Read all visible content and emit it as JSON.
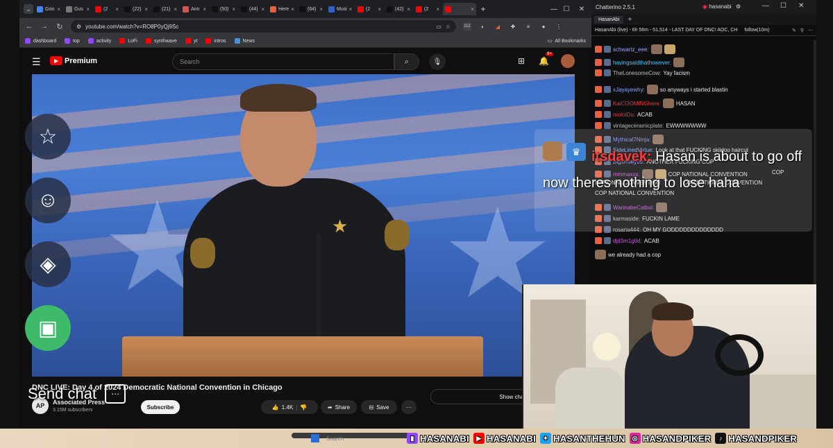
{
  "browser": {
    "tabs": [
      {
        "label": "Goo",
        "color": "#4285f4"
      },
      {
        "label": "Gus",
        "color": "#777777"
      },
      {
        "label": "(2",
        "color": "#ff0000"
      },
      {
        "label": "(22)",
        "color": "#111111"
      },
      {
        "label": "(21)",
        "color": "#111111"
      },
      {
        "label": "Ann",
        "color": "#d9534f"
      },
      {
        "label": "(50)",
        "color": "#111111"
      },
      {
        "label": "(44)",
        "color": "#111111"
      },
      {
        "label": "Here",
        "color": "#e8603c"
      },
      {
        "label": "(64)",
        "color": "#111111"
      },
      {
        "label": "Musi",
        "color": "#2f5fd0"
      },
      {
        "label": "(2",
        "color": "#ff0000"
      },
      {
        "label": "(42)",
        "color": "#111111"
      },
      {
        "label": "(2",
        "color": "#ff0000"
      },
      {
        "label": "",
        "color": "#ff0000",
        "active": true
      }
    ],
    "url": "youtube.com/watch?v=RO8P0yQj9Sc",
    "bookmarks": [
      {
        "label": "dashboard",
        "color": "#9146ff"
      },
      {
        "label": "top",
        "color": "#9146ff"
      },
      {
        "label": "activity",
        "color": "#9146ff"
      },
      {
        "label": "LoFi",
        "color": "#ff0000"
      },
      {
        "label": "synthwave",
        "color": "#ff0000"
      },
      {
        "label": "yt",
        "color": "#ff0000"
      },
      {
        "label": "intros",
        "color": "#ff0000"
      },
      {
        "label": "News",
        "color": "#4a90d9"
      }
    ],
    "all_bookmarks": "All Bookmarks",
    "extension_badge": "112"
  },
  "youtube": {
    "logo": "Premium",
    "search_placeholder": "Search",
    "notification_count": "9+",
    "video_title": "DNC LIVE: Day 4 of 2024 Democratic National Convention in Chicago",
    "channel_initials": "AP",
    "channel_name": "Associated Press",
    "subscribers": "3.15M subscribers",
    "subscribe_label": "Subscribe",
    "like_count": "1.4K",
    "share_label": "Share",
    "save_label": "Save",
    "more_label": "···",
    "show_chat": "Show chat"
  },
  "chatterino": {
    "app_title": "Chatterino 2.5.1",
    "account": "hasanabi",
    "tab": "HasanAbi",
    "channel_header": "HasanAbi (live) - 6h 56m - 51,514 - LAST DAY OF DNC! AOC, CH",
    "follow_status": "follow(10m)",
    "messages": [
      {
        "user": "schwartz_eee:",
        "color": "#9ea7ff",
        "text": "",
        "emotes": 2
      },
      {
        "user": "havingsaidthathowever:",
        "color": "#4fc3f7",
        "text": "",
        "emotes": 1
      },
      {
        "user": "TheLonesomeCow:",
        "color": "#bdbdbd",
        "text": "Yay facism",
        "emotes": 0
      },
      {
        "user": "xJayayewhy:",
        "color": "#7ea8ff",
        "text": "so anyways i started blastin",
        "emotes": 1
      },
      {
        "user": "KaiCOOMINGhere:",
        "color": "#e23b3b",
        "text": "HASAN",
        "emotes": 1
      },
      {
        "user": "molotDu:",
        "color": "#e23b3b",
        "text": "ACAB",
        "emotes": 0
      },
      {
        "user": "vintageceramicplate:",
        "color": "#bdbdbd",
        "text": "EWWWWWWW",
        "emotes": 0
      },
      {
        "user": "Mythical7Ninja:",
        "color": "#7e8cff",
        "text": "",
        "emotes": 1
      },
      {
        "user": "SideLinedVirtue:",
        "color": "#7ea8ff",
        "text": "Look at that FUCKING skiidoo haircut",
        "emotes": 0
      },
      {
        "user": "Bigsmiley09:",
        "color": "#ab8cff",
        "text": "ANOTHER FUCKING COP",
        "emotes": 0
      },
      {
        "user": "mmmaxxx:",
        "color": "#c55bd1",
        "text": "COP NATIONAL CONVENTION",
        "emotes": 2
      },
      {
        "user": "",
        "color": "#dddddd",
        "text": "NATIONAL CONVENTION",
        "emotes": 0
      },
      {
        "user": "",
        "color": "#dddddd",
        "text": "COP NATIONAL CONVENTION",
        "emotes": 0
      },
      {
        "user": "WannabeCatboi:",
        "color": "#c55bd1",
        "text": "",
        "emotes": 1
      },
      {
        "user": "karmaside:",
        "color": "#bdbdbd",
        "text": "FUCKIN LAME",
        "emotes": 0
      },
      {
        "user": "rosaria444:",
        "color": "#bdbdbd",
        "text": "OH MY GODDDDDDDDDDDDD",
        "emotes": 0
      },
      {
        "user": "djd3m1g0d:",
        "color": "#c55bd1",
        "text": "ACAB",
        "emotes": 0
      },
      {
        "user": "",
        "color": "#bdbdbd",
        "text": "we already had a cop",
        "emotes": 1
      }
    ],
    "extra_lines": [
      {
        "text": "COP",
        "offset": 260
      },
      {
        "text": "COP NATIONAL CONVENTION",
        "offset": 132
      }
    ]
  },
  "overlay": {
    "user": "itsdavek:",
    "badge_color": "#3b84d6",
    "message": "Hasan is about to go off now theres nothing to lose haha"
  },
  "left_controls": {
    "send_chat": "Send chat",
    "buttons": [
      {
        "name": "star-icon",
        "glyph": "☆"
      },
      {
        "name": "emoji-icon",
        "glyph": "☺"
      },
      {
        "name": "drop-icon",
        "glyph": "◈"
      },
      {
        "name": "store-icon",
        "glyph": "▣"
      }
    ]
  },
  "taskbar": {
    "search": "Search"
  },
  "socials": [
    {
      "platform": "twitch",
      "handle": "HASANABI",
      "color": "#9146ff",
      "glyph": "▮"
    },
    {
      "platform": "youtube",
      "handle": "HASANABI",
      "color": "#ff0000",
      "glyph": "▶"
    },
    {
      "platform": "twitter",
      "handle": "HASANTHEHUN",
      "color": "#1da1f2",
      "glyph": "✦"
    },
    {
      "platform": "instagram",
      "handle": "HASANDPIKER",
      "color": "#d6249f",
      "glyph": "◎"
    },
    {
      "platform": "tiktok",
      "handle": "HASANDPIKER",
      "color": "#111111",
      "glyph": "♪"
    }
  ]
}
